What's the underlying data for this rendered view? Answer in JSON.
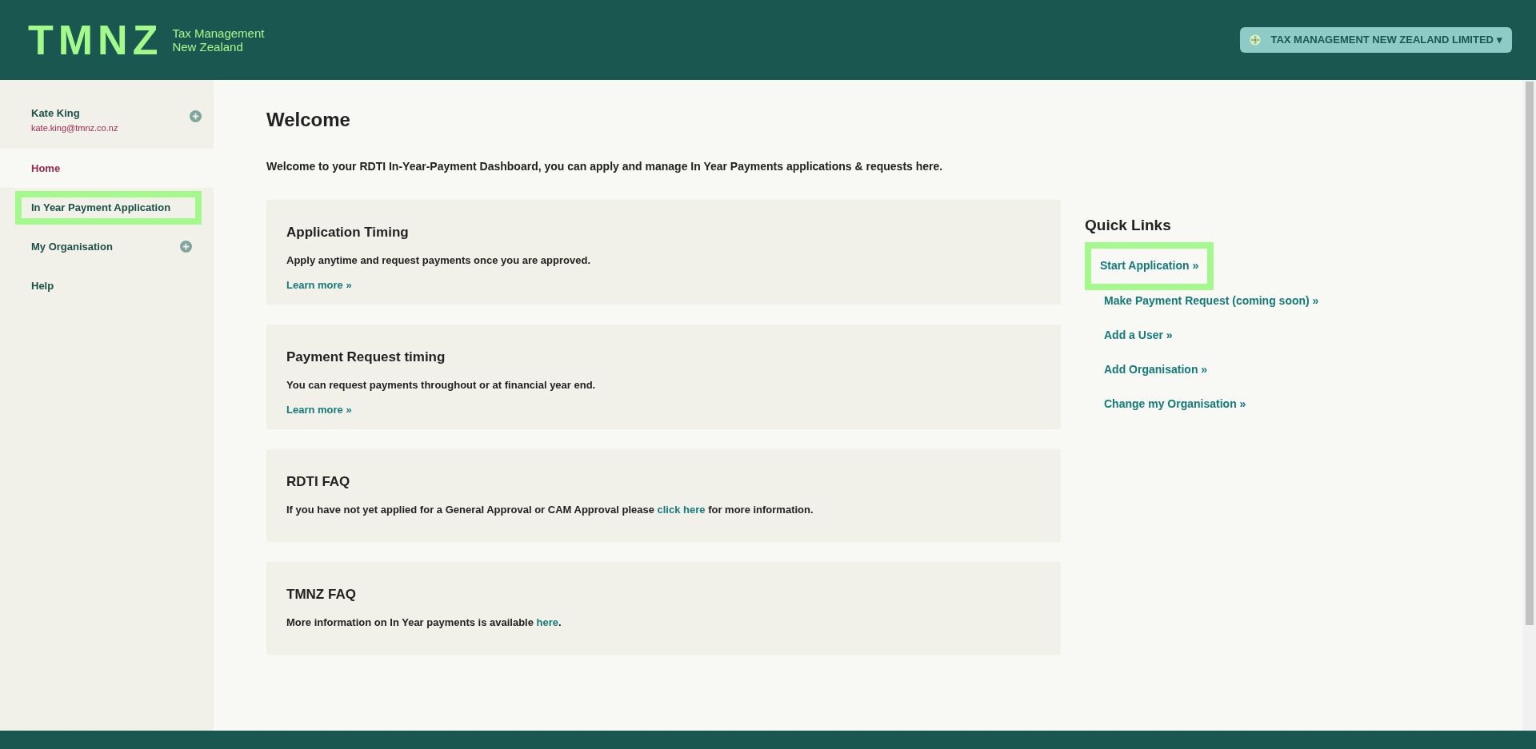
{
  "header": {
    "logo": "TMNZ",
    "logo_tagline": [
      "Tax Management",
      "New Zealand"
    ],
    "org_menu": {
      "label": "TAX MANAGEMENT NEW ZEALAND LIMITED",
      "caret": "▾"
    }
  },
  "user": {
    "name": "Kate King",
    "email": "kate.king@tmnz.co.nz",
    "expandable": true
  },
  "sidebar": {
    "items": [
      {
        "label": "Home",
        "selected": true,
        "highlighted": false,
        "expandable": false
      },
      {
        "label": "In Year Payment Application",
        "selected": false,
        "highlighted": true,
        "expandable": false
      },
      {
        "label": "My Organisation",
        "selected": false,
        "highlighted": false,
        "expandable": true
      },
      {
        "label": "Help",
        "selected": false,
        "highlighted": false,
        "expandable": false
      }
    ]
  },
  "main": {
    "title": "Welcome",
    "intro": "Welcome to your RDTI In-Year-Payment Dashboard, you can apply and manage In Year Payments applications & requests here.",
    "cards": [
      {
        "title": "Application Timing",
        "text": [
          {
            "text": "Apply anytime and request payments once you are approved.",
            "link": false
          }
        ],
        "more": "Learn more »"
      },
      {
        "title": "Payment Request timing",
        "text": [
          {
            "text": "You can request payments throughout or at financial year end.",
            "link": false
          }
        ],
        "more": "Learn more »"
      },
      {
        "title": "RDTI FAQ",
        "text": [
          {
            "text": "If you have not yet applied for a General Approval or CAM Approval please ",
            "link": false
          },
          {
            "text": "click here",
            "link": true
          },
          {
            "text": " for more information.",
            "link": false
          }
        ]
      },
      {
        "title": "TMNZ FAQ",
        "text": [
          {
            "text": "More information on In Year payments is available ",
            "link": false
          },
          {
            "text": "here",
            "link": true
          },
          {
            "text": ".",
            "link": false
          }
        ]
      }
    ]
  },
  "quick_links": {
    "title": "Quick Links",
    "items": [
      {
        "label": "Start Application »",
        "highlighted": true
      },
      {
        "label": "Make Payment Request (coming soon) »",
        "highlighted": false
      },
      {
        "label": "Add a User »",
        "highlighted": false
      },
      {
        "label": "Add Organisation »",
        "highlighted": false
      },
      {
        "label": "Change my Organisation »",
        "highlighted": false
      }
    ]
  }
}
